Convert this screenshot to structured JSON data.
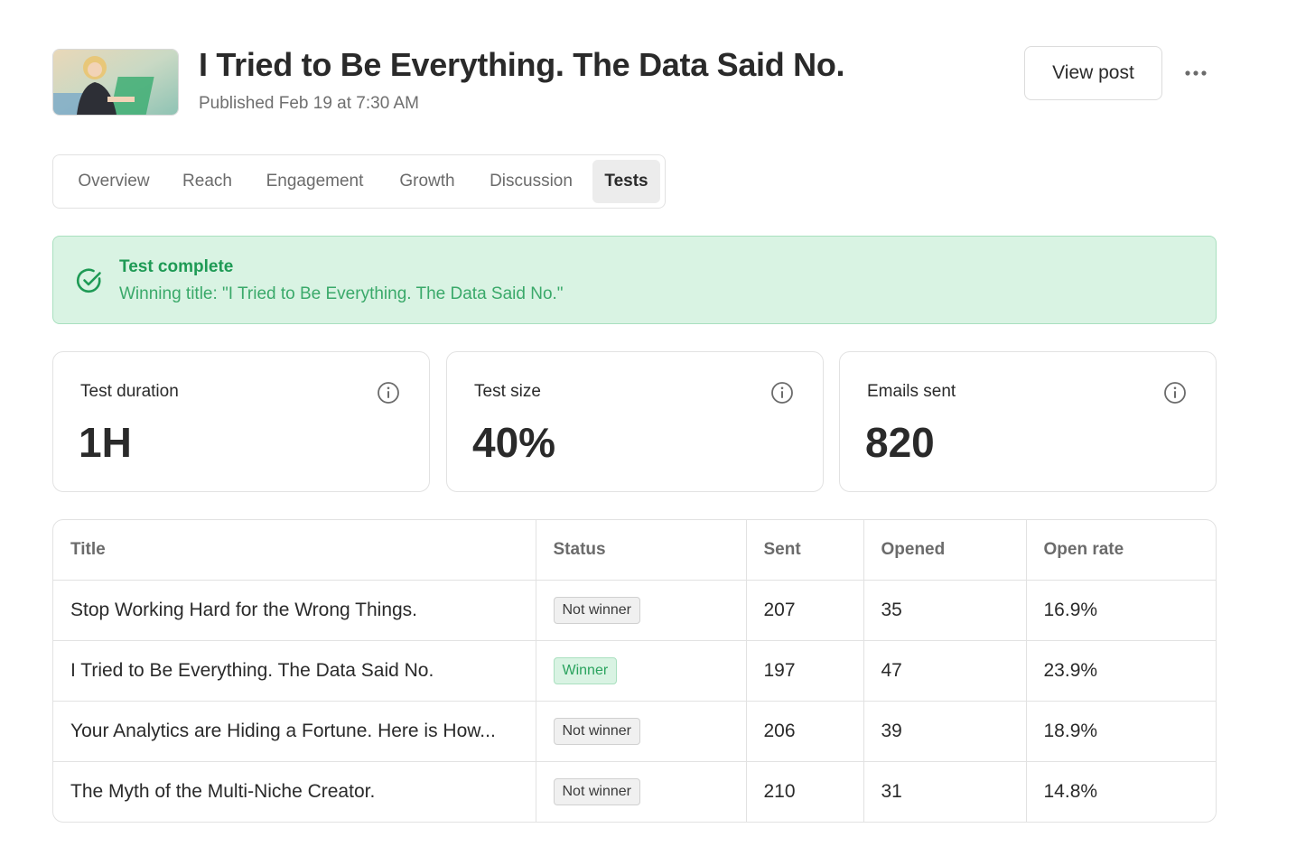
{
  "header": {
    "title": "I Tried to Be Everything. The Data Said No.",
    "published": "Published Feb 19 at 7:30 AM",
    "view_post_label": "View post",
    "more_icon": "more-horizontal-icon"
  },
  "tabs": [
    {
      "label": "Overview",
      "active": false
    },
    {
      "label": "Reach",
      "active": false
    },
    {
      "label": "Engagement",
      "active": false
    },
    {
      "label": "Growth",
      "active": false
    },
    {
      "label": "Discussion",
      "active": false
    },
    {
      "label": "Tests",
      "active": true
    }
  ],
  "banner": {
    "title": "Test complete",
    "subtitle": "Winning title: \"I Tried to Be Everything. The Data Said No.\"",
    "icon": "check-circle-icon",
    "color": "#1e9a55"
  },
  "stats": [
    {
      "label": "Test duration",
      "value": "1H"
    },
    {
      "label": "Test size",
      "value": "40%"
    },
    {
      "label": "Emails sent",
      "value": "820"
    }
  ],
  "table": {
    "columns": [
      "Title",
      "Status",
      "Sent",
      "Opened",
      "Open rate"
    ],
    "rows": [
      {
        "title": "Stop Working Hard for the Wrong Things.",
        "status": "Not winner",
        "sent": "207",
        "opened": "35",
        "open_rate": "16.9%"
      },
      {
        "title": "I Tried to Be Everything. The Data Said No.",
        "status": "Winner",
        "sent": "197",
        "opened": "47",
        "open_rate": "23.9%"
      },
      {
        "title": "Your Analytics are Hiding a Fortune. Here is How...",
        "status": "Not winner",
        "sent": "206",
        "opened": "39",
        "open_rate": "18.9%"
      },
      {
        "title": "The Myth of the Multi-Niche Creator.",
        "status": "Not winner",
        "sent": "210",
        "opened": "31",
        "open_rate": "14.8%"
      }
    ]
  },
  "colors": {
    "accent_green": "#1e9a55",
    "banner_bg": "#d9f3e3",
    "border": "#e2e2e2"
  }
}
